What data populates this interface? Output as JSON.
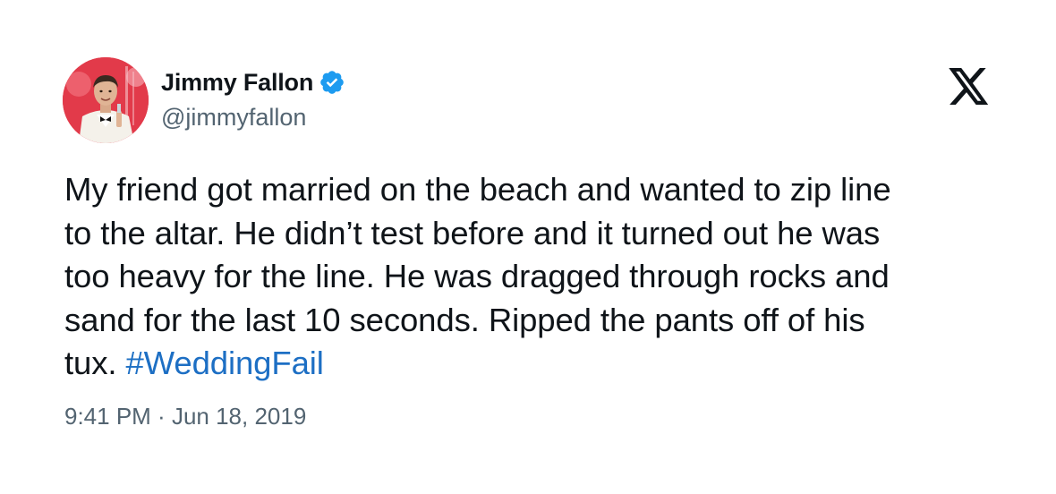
{
  "author": {
    "display_name": "Jimmy Fallon",
    "handle": "@jimmyfallon",
    "verified_icon": "verified-badge-icon",
    "avatar_icon": "profile-photo"
  },
  "platform": {
    "logo_icon": "x-logo-icon"
  },
  "tweet": {
    "text_lines": [
      "My friend got married on the beach and wanted to zip line",
      "to the altar. He didn’t test before and it turned out he was",
      "too heavy for the line. He was dragged through rocks and",
      "sand for the last 10 seconds. Ripped the pants off of his",
      "tux. "
    ],
    "hashtag": "#WeddingFail",
    "time": "9:41 PM",
    "separator": " · ",
    "date": "Jun 18, 2019"
  },
  "colors": {
    "hashtag": "#1d6fc4",
    "verified": "#1d9bf0",
    "secondary_text": "#536471",
    "primary_text": "#0f1419",
    "avatar_background": "#e23a4a"
  }
}
